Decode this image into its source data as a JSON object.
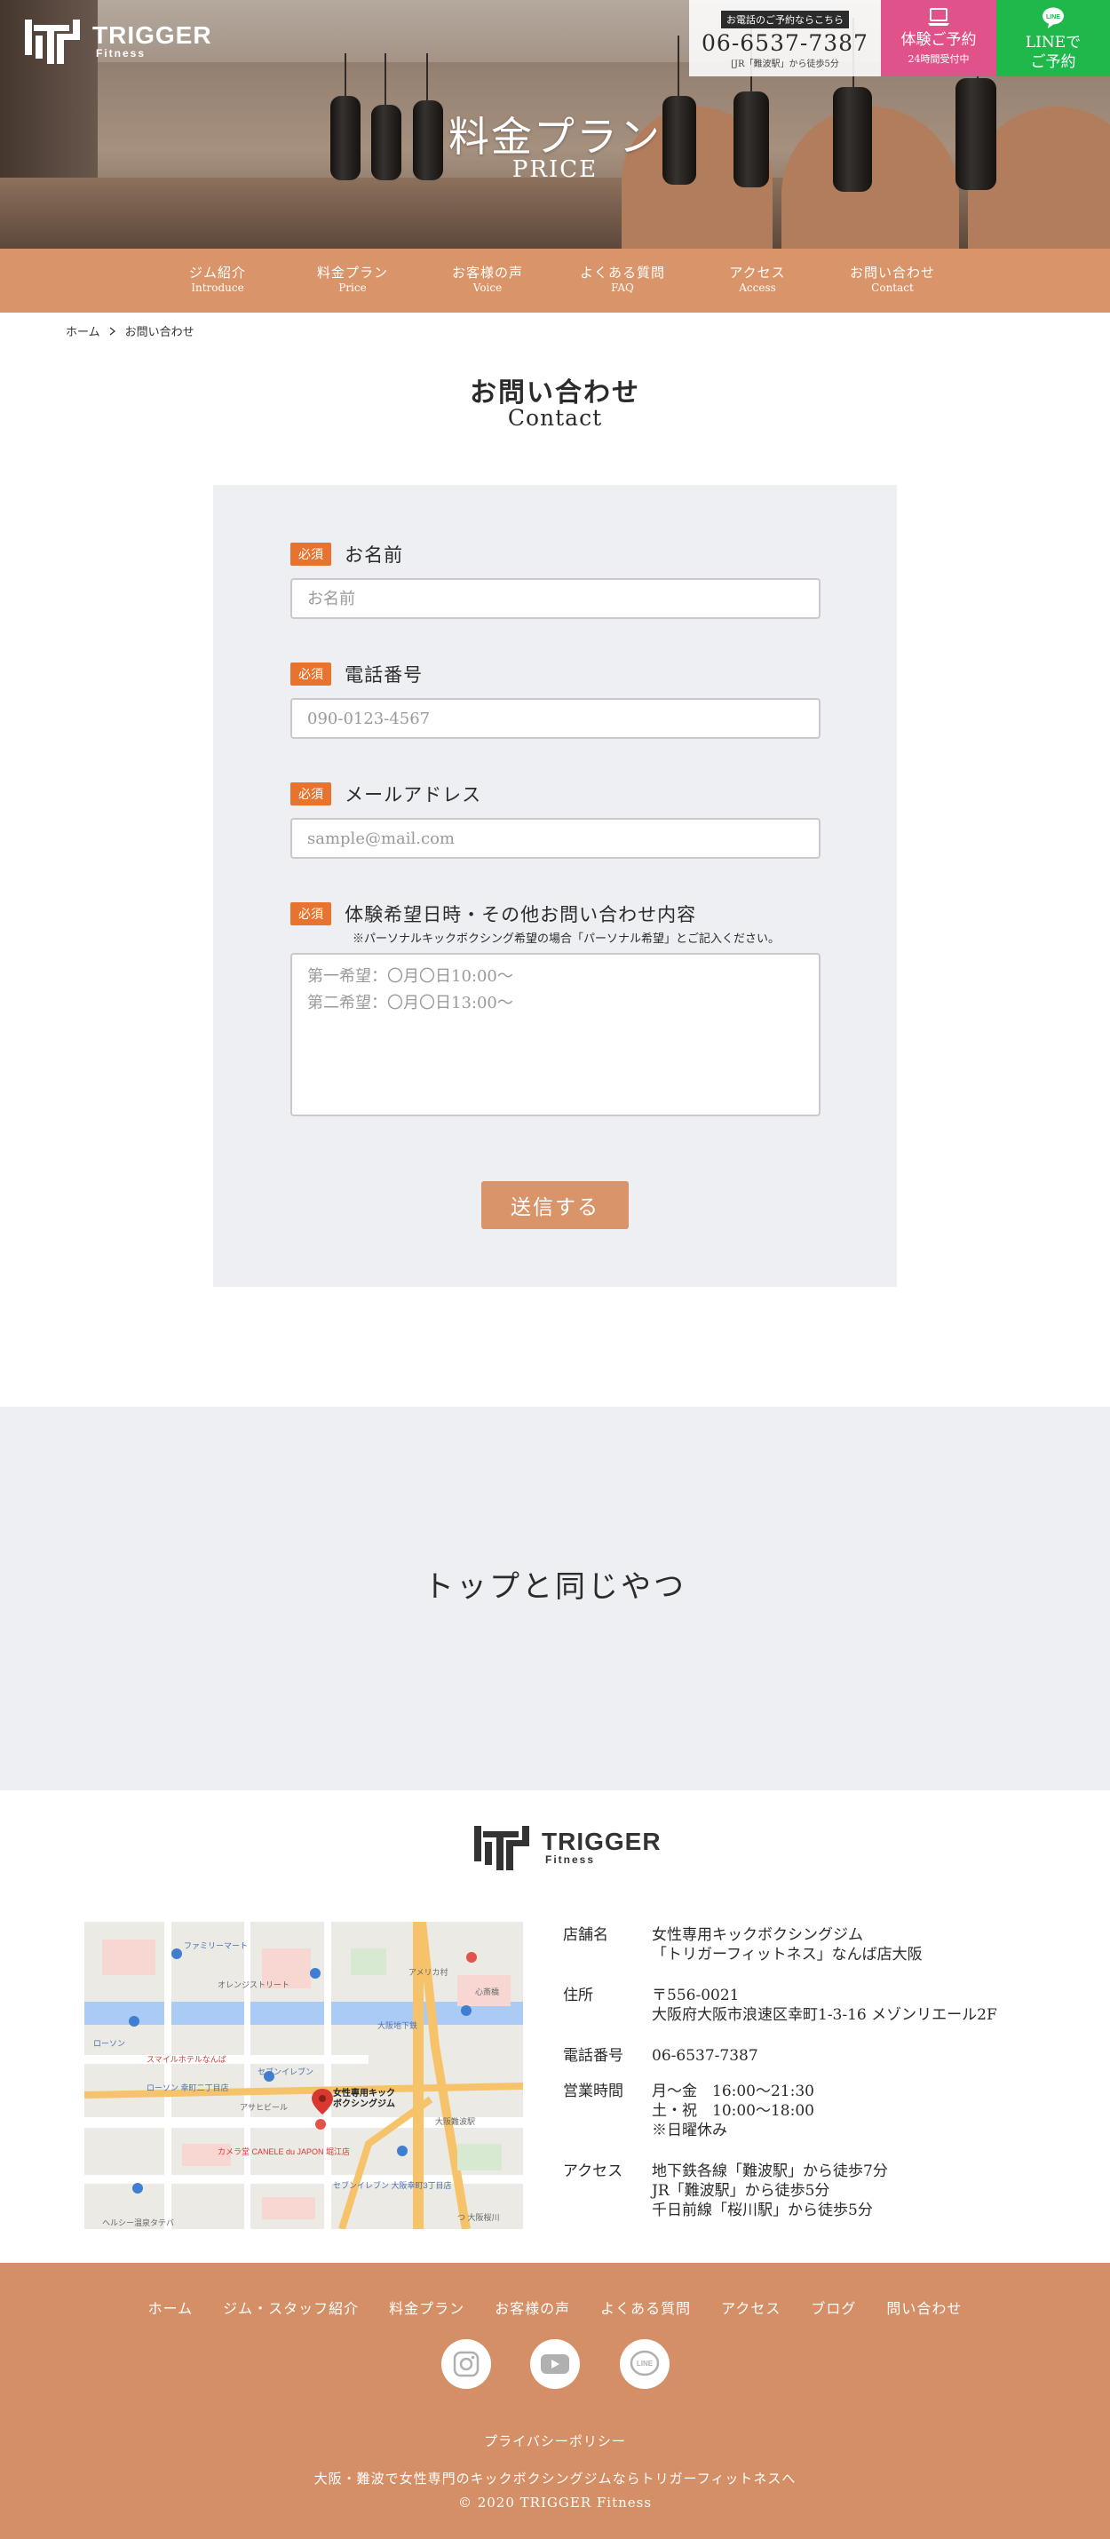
{
  "brand": {
    "name": "TRIGGER",
    "sub": "Fitness"
  },
  "header": {
    "tel_caption": "お電話のご予約ならこちら",
    "tel_number": "06-6537-7387",
    "tel_walk": "[JR「難波駅」から徒歩5分",
    "trial_label": "体験ご予約",
    "trial_sub": "24時間受付中",
    "line_label_1": "LINEで",
    "line_label_2": "ご予約",
    "line_icon_text": "LINE",
    "hero_title": "料金プラン",
    "hero_subtitle": "PRICE"
  },
  "nav": [
    {
      "jp": "ジム紹介",
      "en": "Introduce"
    },
    {
      "jp": "料金プラン",
      "en": "Price"
    },
    {
      "jp": "お客様の声",
      "en": "Voice"
    },
    {
      "jp": "よくある質問",
      "en": "FAQ"
    },
    {
      "jp": "アクセス",
      "en": "Access"
    },
    {
      "jp": "お問い合わせ",
      "en": "Contact"
    }
  ],
  "breadcrumb": {
    "home": "ホーム",
    "sep": "＞",
    "current": "お問い合わせ"
  },
  "page": {
    "title_jp": "お問い合わせ",
    "title_en": "Contact"
  },
  "form": {
    "required_badge": "必須",
    "name": {
      "label": "お名前",
      "placeholder": "お名前"
    },
    "phone": {
      "label": "電話番号",
      "placeholder": "090-0123-4567"
    },
    "email": {
      "label": "メールアドレス",
      "placeholder": "sample@mail.com"
    },
    "message": {
      "label": "体験希望日時・その他お問い合わせ内容",
      "note": "※パーソナルキックボクシング希望の場合「パーソナル希望」とご記入ください。",
      "placeholder": "第一希望：〇月〇日10:00〜\n第二希望：〇月〇日13:00〜"
    },
    "submit_label": "送信する"
  },
  "placeholder_block": {
    "text": "トップと同じやつ"
  },
  "store": {
    "rows": [
      {
        "key": "店舗名",
        "lines": [
          "女性専用キックボクシングジム",
          "「トリガーフィットネス」なんば店大阪"
        ]
      },
      {
        "key": "住所",
        "lines": [
          "〒556-0021",
          "大阪府大阪市浪速区幸町1-3-16 メゾンリエール2F"
        ]
      },
      {
        "key": "電話番号",
        "lines": [
          "06-6537-7387"
        ]
      },
      {
        "key": "営業時間",
        "lines": [
          "月〜金　16:00〜21:30",
          "土・祝　10:00〜18:00",
          "※日曜休み"
        ]
      },
      {
        "key": "アクセス",
        "lines": [
          "地下鉄各線「難波駅」から徒歩7分",
          "JR「難波駅」から徒歩5分",
          "千日前線「桜川駅」から徒歩5分"
        ]
      }
    ]
  },
  "map": {
    "pin_label_1": "女性専用キック",
    "pin_label_2": "ボクシングジム",
    "labels": [
      "ファミリーマート",
      "ローソン",
      "セブンイレブン",
      "大阪地下鉄",
      "オレンジストリート",
      "スマイルホテルなんば",
      "カメラ堂 CANELE du JAPON 堀江店",
      "アメリカ村",
      "心斎橋",
      "大阪難波駅",
      "ローソン 幸町二丁目店",
      "ヘルシー温泉タテバ",
      "アサヒビール",
      "セブンイレブン 大阪幸町3丁目店",
      "つ 大阪桜川"
    ]
  },
  "footer": {
    "nav": [
      "ホーム",
      "ジム・スタッフ紹介",
      "料金プラン",
      "お客様の声",
      "よくある質問",
      "アクセス",
      "ブログ",
      "問い合わせ"
    ],
    "line_icon_text": "LINE",
    "privacy": "プライバシーポリシー",
    "tagline": "大阪・難波で女性専門のキックボクシングジムならトリガーフィットネスへ",
    "copyright": "© 2020 TRIGGER Fitness"
  },
  "colors": {
    "accent": "#d9946a",
    "required": "#e8732f",
    "pink": "#e0538a",
    "line_green": "#1fb84a",
    "panel": "#eeeff2"
  }
}
